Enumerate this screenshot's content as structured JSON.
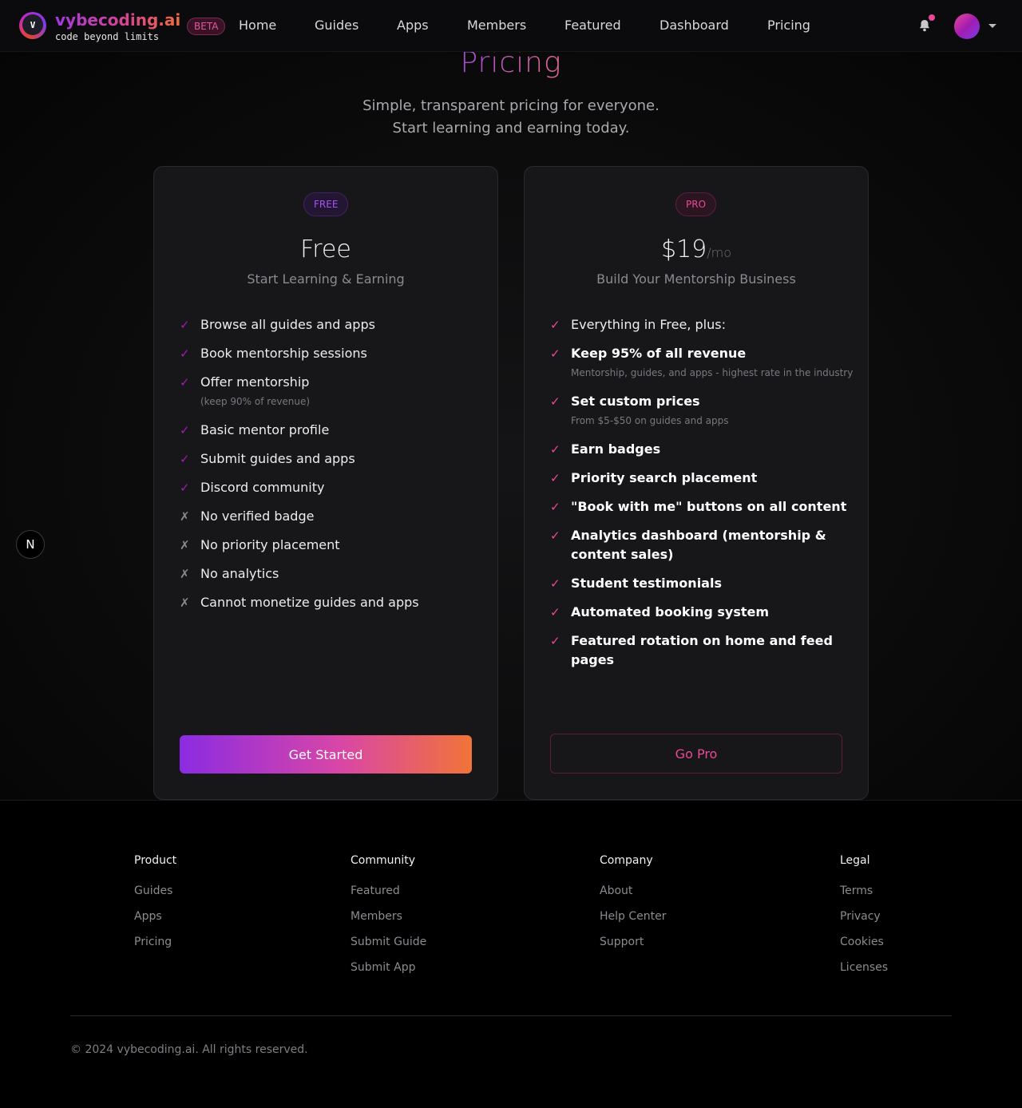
{
  "nav": {
    "logo_letter": "V",
    "brand": "vybecoding.ai",
    "tagline": "code beyond limits",
    "beta": "BETA",
    "links": [
      "Home",
      "Guides",
      "Apps",
      "Members",
      "Featured",
      "Dashboard",
      "Pricing"
    ]
  },
  "hero": {
    "title": "Pricing",
    "subtitle_line1": "Simple, transparent pricing for everyone.",
    "subtitle_line2": "Start learning and earning today."
  },
  "plans": {
    "free": {
      "badge": "FREE",
      "price": "Free",
      "subtitle": "Start Learning & Earning",
      "features": [
        {
          "mark": "✓",
          "text": "Browse all guides and apps"
        },
        {
          "mark": "✓",
          "text": "Book mentorship sessions"
        },
        {
          "mark": "✓",
          "text": "Offer mentorship",
          "note": "(keep 90% of revenue)"
        },
        {
          "mark": "✓",
          "text": "Basic mentor profile"
        },
        {
          "mark": "✓",
          "text": "Submit guides and apps"
        },
        {
          "mark": "✓",
          "text": "Discord community"
        },
        {
          "mark": "✗",
          "text": "No verified badge"
        },
        {
          "mark": "✗",
          "text": "No priority placement"
        },
        {
          "mark": "✗",
          "text": "No analytics"
        },
        {
          "mark": "✗",
          "text": "Cannot monetize guides and apps"
        }
      ],
      "cta": "Get Started"
    },
    "pro": {
      "badge": "PRO",
      "price": "$19",
      "price_period": "/mo",
      "subtitle": "Build Your Mentorship Business",
      "features": [
        {
          "mark": "✓",
          "text": "Everything in Free, plus:"
        },
        {
          "mark": "✓",
          "text": "Keep 95% of all revenue",
          "note": "Mentorship, guides, and apps - highest rate in the industry"
        },
        {
          "mark": "✓",
          "text": "Set custom prices",
          "note": "From $5-$50 on guides and apps"
        },
        {
          "mark": "✓",
          "text": "Earn badges"
        },
        {
          "mark": "✓",
          "text": "Priority search placement"
        },
        {
          "mark": "✓",
          "text": "\"Book with me\" buttons on all content"
        },
        {
          "mark": "✓",
          "text": "Analytics dashboard (mentorship & content sales)"
        },
        {
          "mark": "✓",
          "text": "Student testimonials"
        },
        {
          "mark": "✓",
          "text": "Automated booking system"
        },
        {
          "mark": "✓",
          "text": "Featured rotation on home and feed pages"
        }
      ],
      "cta": "Go Pro"
    }
  },
  "floating_badge": "N",
  "footer": {
    "columns": [
      {
        "title": "Product",
        "links": [
          "Guides",
          "Apps",
          "Pricing"
        ]
      },
      {
        "title": "Community",
        "links": [
          "Featured",
          "Members",
          "Submit Guide",
          "Submit App"
        ]
      },
      {
        "title": "Company",
        "links": [
          "About",
          "Help Center",
          "Support"
        ]
      },
      {
        "title": "Legal",
        "links": [
          "Terms",
          "Privacy",
          "Cookies",
          "Licenses"
        ]
      }
    ],
    "copyright": "© 2024 vybecoding.ai. All rights reserved."
  },
  "colors": {
    "accent_purple": "#a855f7",
    "accent_pink": "#ec4899",
    "accent_orange": "#f07438"
  },
  "icons": [
    "bell-icon",
    "chevron-down-icon",
    "check-icon",
    "x-icon"
  ]
}
